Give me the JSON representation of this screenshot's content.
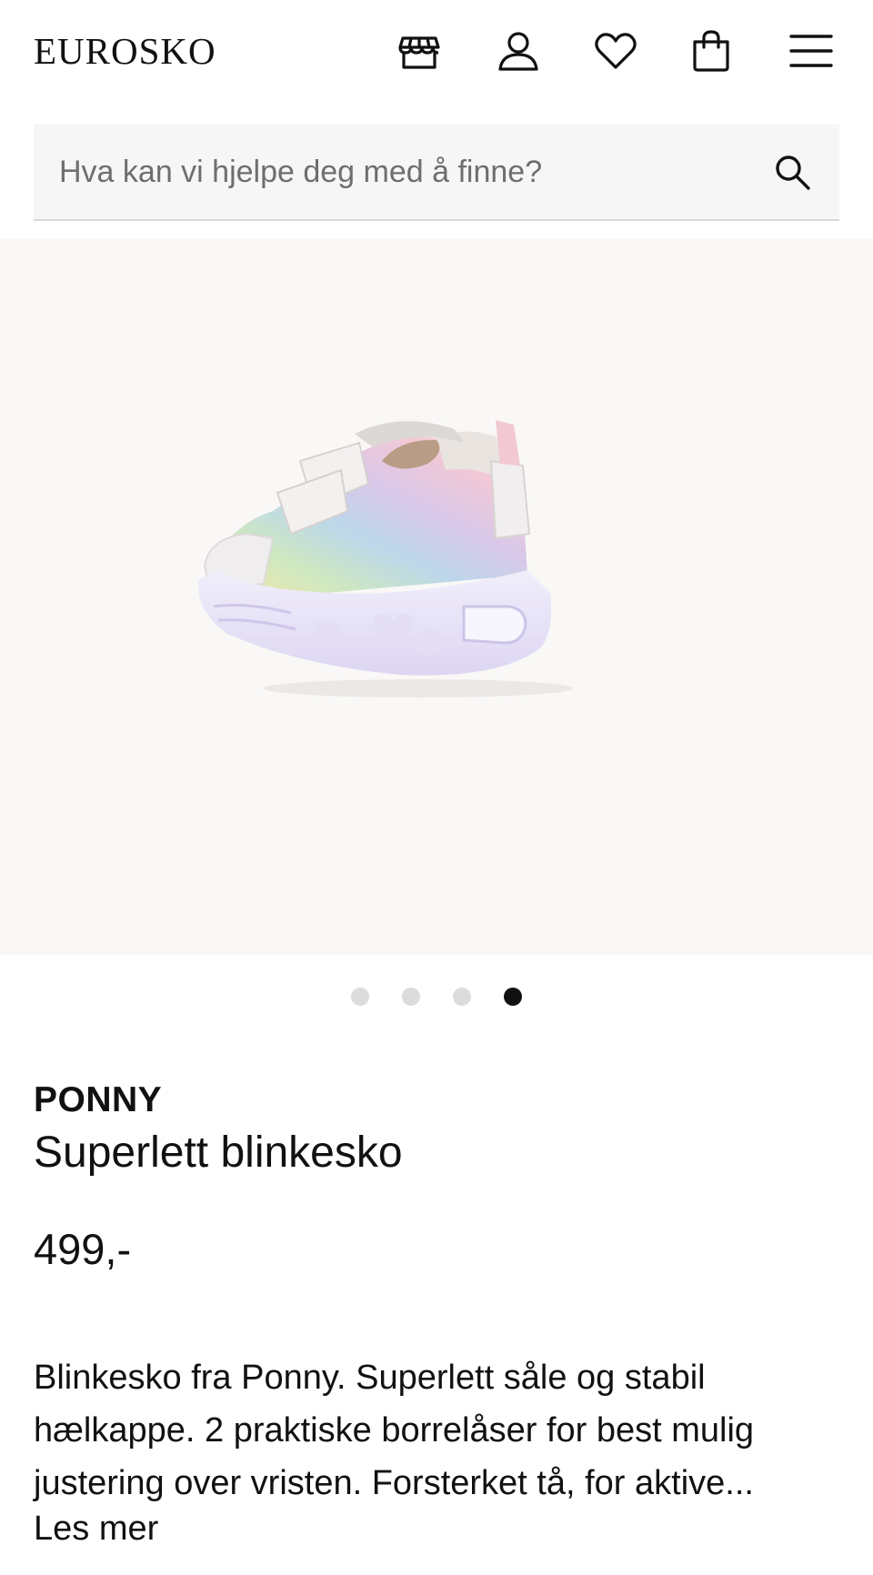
{
  "header": {
    "logo": "EUROSKO",
    "icons": [
      "store-icon",
      "user-icon",
      "heart-icon",
      "shopping-bag-icon",
      "menu-icon"
    ]
  },
  "search": {
    "placeholder": "Hva kan vi hjelpe deg med å finne?",
    "value": ""
  },
  "gallery": {
    "image_count": 4,
    "active_index": 4,
    "zoom_icon": "zoom-in-icon"
  },
  "product": {
    "brand": "PONNY",
    "name": "Superlett blinkesko",
    "price": "499,-",
    "description": "Blinkesko fra Ponny. Superlett såle og stabil hælkappe. 2 praktiske borrelåser for best mulig justering over vristen. Forsterket tå, for aktive...",
    "read_more": "Les mer"
  },
  "colors": {
    "text": "#111111",
    "search_bg": "#f6f6f6",
    "gallery_bg": "#f9f8f7",
    "dot_inactive": "#dcdcdc",
    "dot_active": "#111111"
  }
}
